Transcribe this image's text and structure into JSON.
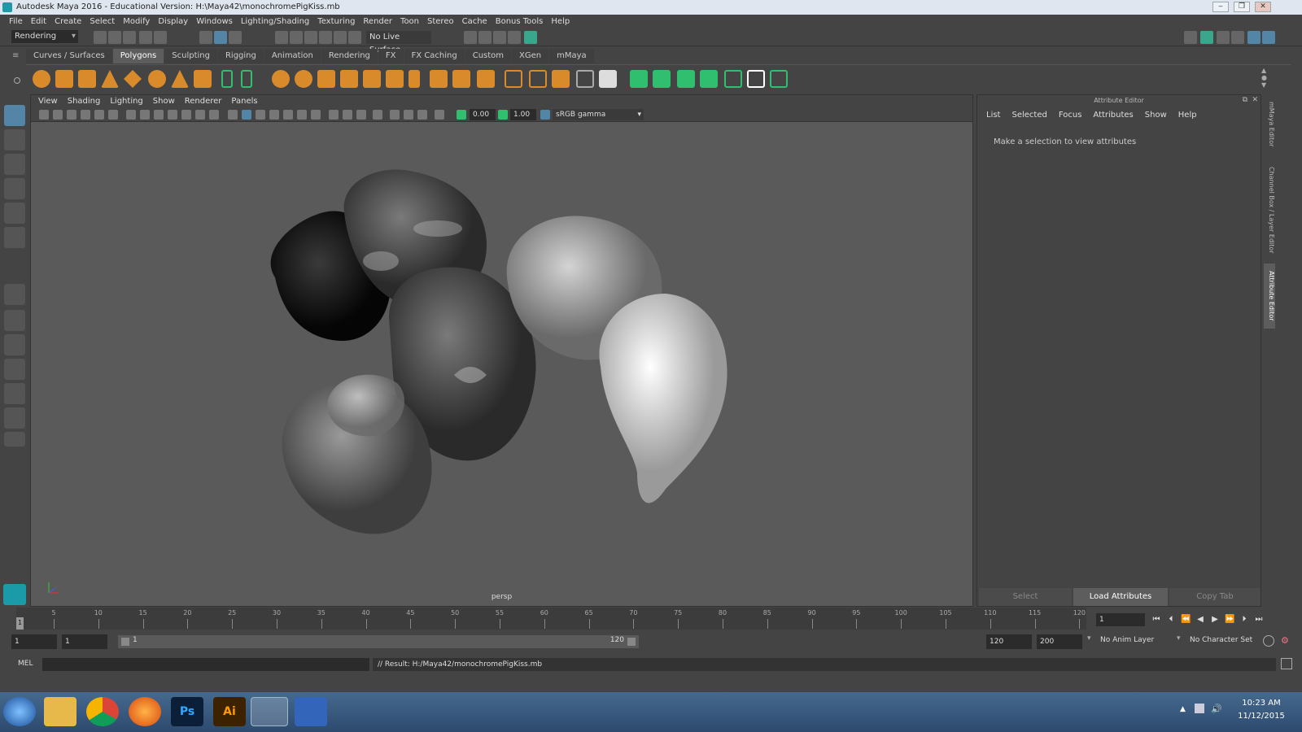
{
  "window": {
    "title": "Autodesk Maya 2016 - Educational Version: H:\\Maya42\\monochromePigKiss.mb",
    "minimize": "‒",
    "maximize": "❐",
    "close": "✕"
  },
  "menu": [
    "File",
    "Edit",
    "Create",
    "Select",
    "Modify",
    "Display",
    "Windows",
    "Lighting/Shading",
    "Texturing",
    "Render",
    "Toon",
    "Stereo",
    "Cache",
    "Bonus Tools",
    "Help"
  ],
  "statusline": {
    "menuset": "Rendering",
    "live_surface": "No Live Surface"
  },
  "shelf": {
    "tabs": [
      "Curves / Surfaces",
      "Polygons",
      "Sculpting",
      "Rigging",
      "Animation",
      "Rendering",
      "FX",
      "FX Caching",
      "Custom",
      "XGen",
      "mMaya"
    ],
    "active": "Polygons"
  },
  "viewport": {
    "menu": [
      "View",
      "Shading",
      "Lighting",
      "Show",
      "Renderer",
      "Panels"
    ],
    "exposure": "0.00",
    "gamma": "1.00",
    "color_space": "sRGB gamma",
    "camera": "persp"
  },
  "attribute_editor": {
    "title": "Attribute Editor",
    "menu": [
      "List",
      "Selected",
      "Focus",
      "Attributes",
      "Show",
      "Help"
    ],
    "message": "Make a selection to view attributes",
    "buttons": {
      "select": "Select",
      "load": "Load Attributes",
      "copy": "Copy Tab"
    }
  },
  "side_tabs": [
    "mMaya Editor",
    "Channel Box / Layer Editor",
    "Attribute Editor"
  ],
  "timeline": {
    "ticks": [
      "5",
      "10",
      "15",
      "20",
      "25",
      "30",
      "35",
      "40",
      "45",
      "50",
      "55",
      "60",
      "65",
      "70",
      "75",
      "80",
      "85",
      "90",
      "95",
      "100",
      "105",
      "110",
      "115",
      "120"
    ],
    "start_marker": "1",
    "current_frame": "1"
  },
  "range": {
    "start": "1",
    "playback_start": "1",
    "range_start": "1",
    "range_end": "120",
    "playback_end": "120",
    "end": "200",
    "anim_layer": "No Anim Layer",
    "character_set": "No Character Set"
  },
  "command": {
    "lang": "MEL",
    "result": "// Result: H:/Maya42/monochromePigKiss.mb"
  },
  "taskbar": {
    "time": "10:23 AM",
    "date": "11/12/2015",
    "apps": [
      "start",
      "explorer",
      "chrome",
      "firefox",
      "photoshop",
      "illustrator",
      "maya",
      "mudbox"
    ],
    "ps": "Ps",
    "ai": "Ai"
  }
}
